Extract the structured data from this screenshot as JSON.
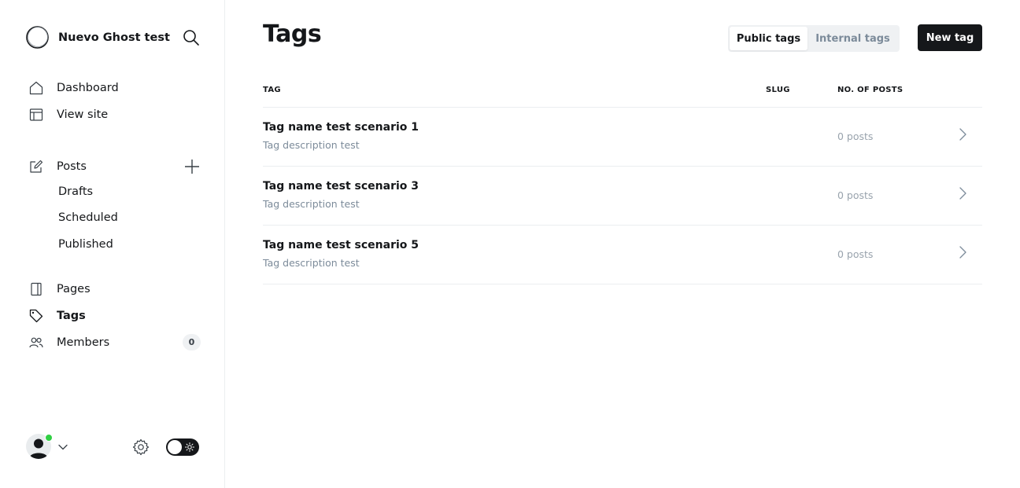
{
  "site": {
    "name": "Nuevo Ghost test"
  },
  "nav": {
    "dashboard": "Dashboard",
    "view_site": "View site",
    "posts": "Posts",
    "posts_sub": [
      "Drafts",
      "Scheduled",
      "Published"
    ],
    "pages": "Pages",
    "tags": "Tags",
    "members": "Members",
    "members_count": "0"
  },
  "header": {
    "title": "Tags",
    "tab_public": "Public tags",
    "tab_internal": "Internal tags",
    "new_button": "New tag"
  },
  "table": {
    "columns": [
      "TAG",
      "SLUG",
      "NO. OF POSTS"
    ],
    "rows": [
      {
        "name": "Tag name test scenario 1",
        "description": "Tag description test",
        "slug": "",
        "posts": "0 posts"
      },
      {
        "name": "Tag name test scenario 3",
        "description": "Tag description test",
        "slug": "",
        "posts": "0 posts"
      },
      {
        "name": "Tag name test scenario 5",
        "description": "Tag description test",
        "slug": "",
        "posts": "0 posts"
      }
    ]
  },
  "status": {
    "online_color": "#30cf43",
    "accent_color": "#15171a"
  }
}
